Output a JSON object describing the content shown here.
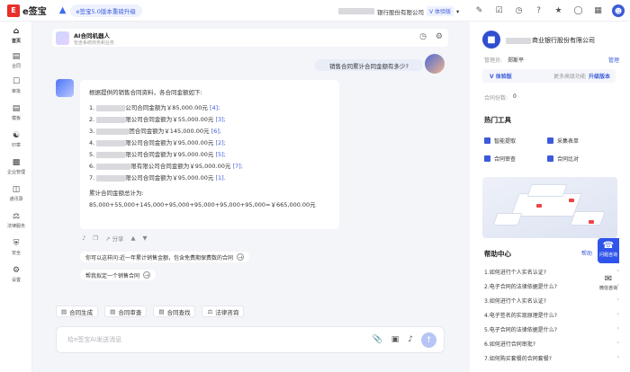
{
  "app": {
    "logo_glyph": "E",
    "logo_text": "e签宝",
    "upgrade_label": "e签宝5.0版本重磅升级"
  },
  "topbar": {
    "company": "银行股份有限公司",
    "version_tag": "V 体验版",
    "icons": [
      "chevron-down-icon",
      "edit-icon",
      "check-icon",
      "clock-icon",
      "help-icon",
      "bell-icon",
      "globe-icon",
      "grid-icon",
      "avatar"
    ]
  },
  "nav": {
    "items": [
      {
        "label": "首页",
        "icon": "home-icon",
        "active": true
      },
      {
        "label": "合同",
        "icon": "contract-icon"
      },
      {
        "label": "审批",
        "icon": "approval-icon"
      },
      {
        "label": "模板",
        "icon": "template-icon"
      },
      {
        "label": "印章",
        "icon": "seal-icon"
      },
      {
        "label": "企业管理",
        "icon": "enterprise-icon"
      },
      {
        "label": "通讯录",
        "icon": "contacts-icon"
      },
      {
        "label": "法律服务",
        "icon": "law-icon"
      },
      {
        "label": "安全",
        "icon": "shield-icon"
      },
      {
        "label": "设置",
        "icon": "gear-icon"
      }
    ]
  },
  "chat": {
    "bot_name": "AI合同机器人",
    "bot_sub": "包含系统商务和业务",
    "user_question": "销售合同累计合同金额有多少?",
    "answer": {
      "intro": "根据提供的销售合同资料，各合同金额如下:",
      "items": [
        {
          "n": "1.",
          "text": "公司合同金额为￥85,000.00元",
          "ref": "[4];"
        },
        {
          "n": "2.",
          "text": "限公司合同金额为￥55,000.00元",
          "ref": "[3];"
        },
        {
          "n": "3.",
          "text": "团合同金额为￥145,000.00元",
          "ref": "[6];"
        },
        {
          "n": "4.",
          "text": "限公司合同金额为￥95,000.00元",
          "ref": "[2];"
        },
        {
          "n": "5.",
          "text": "限公司合同金额为￥95,000.00元",
          "ref": "[5];"
        },
        {
          "n": "6.",
          "text": "限有限公司合同金额为￥95,000.00元",
          "ref": "[7];"
        },
        {
          "n": "7.",
          "text": "限公司合同金额为￥95,000.00元",
          "ref": "[1]."
        }
      ],
      "summary_label": "累计合同金额总计为:",
      "summary": "85,000+55,000+145,000+95,000+95,000+95,000+95,000=￥665,000.00元"
    },
    "share_label": "分享",
    "suggestions": [
      "你可以这样问:近一年累计销售金额，包含免费期保费数的合同",
      "帮我拟定一个销售合同"
    ],
    "tools": [
      {
        "label": "合同生成",
        "icon": "doc-icon"
      },
      {
        "label": "合同审查",
        "icon": "review-icon"
      },
      {
        "label": "合同查找",
        "icon": "find-icon"
      },
      {
        "label": "法律咨询",
        "icon": "law-icon"
      }
    ],
    "input_placeholder": "给e签宝AI发送消息"
  },
  "right": {
    "company": "商业银行股份有限公司",
    "admin_label": "管理员:",
    "admin_name": "郑斯平",
    "manage": "管理",
    "edition": "V 体验版",
    "edition_tip": "更多高级功能",
    "edition_up": "升级版本",
    "contracts_label": "合同份数:",
    "contracts_count": "0",
    "hot_tools_title": "热门工具",
    "hot_tools": [
      "智能提取",
      "采集表单",
      "合同审查",
      "合同比对"
    ],
    "help_title": "帮助中心",
    "help_more": "帮助",
    "help_items": [
      "1.如何进行个人实名认证?",
      "2.电子合同的法律依据是什么?",
      "3.如何进行个人实名认证?",
      "4.电子签名的实现原理是什么?",
      "5.电子合同的法律依据是什么?",
      "6.如何进行合同审批?",
      "7.如何购买套餐的合同套餐?"
    ]
  },
  "float": {
    "service": "问题咨询",
    "wechat": "微信咨询"
  }
}
